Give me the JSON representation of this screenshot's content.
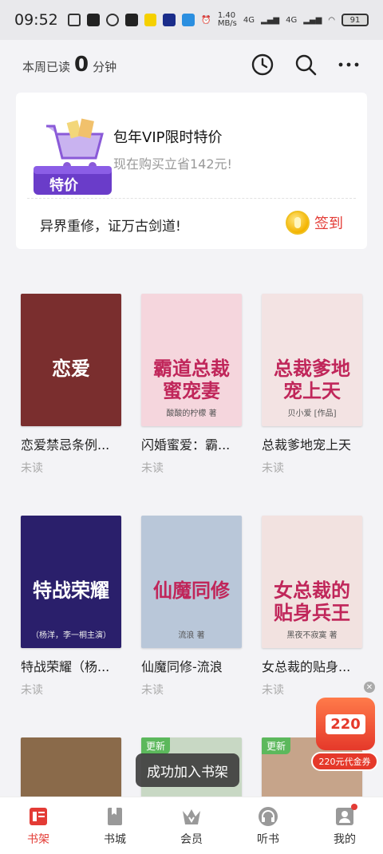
{
  "status_bar": {
    "time": "09:52",
    "net_speed": "1.40\nMB/s",
    "signal1": "4G",
    "signal2": "4G",
    "battery": "91"
  },
  "header": {
    "read_prefix": "本周已读",
    "read_minutes": "0",
    "read_suffix": "分钟"
  },
  "promo": {
    "vip_badge": "特价",
    "title": "包年VIP限时特价",
    "subtitle": "现在购买立省142元!",
    "slogan": "异界重修，证万古剑道!",
    "signin_label": "签到"
  },
  "books": [
    {
      "title": "恋爱禁忌条例...",
      "status": "未读",
      "cover_text": "恋爱",
      "cover_bg": "#7a2e2e",
      "updated": false
    },
    {
      "title": "闪婚蜜爱：霸...",
      "status": "未读",
      "cover_text": "霸道总裁\n蜜宠妻",
      "cover_sub": "酸酸的柠檬 著",
      "cover_bg": "#f5d6dd",
      "updated": false
    },
    {
      "title": "总裁爹地宠上天",
      "status": "未读",
      "cover_text": "总裁爹地\n宠上天",
      "cover_sub": "贝小爱 [作品]",
      "cover_bg": "#f3e3e3",
      "updated": false
    },
    {
      "title": "特战荣耀（杨...",
      "status": "未读",
      "cover_text": "特战荣耀",
      "cover_sub": "（杨洋，李一桐主演）",
      "cover_bg": "#2a1f6b",
      "updated": false
    },
    {
      "title": "仙魔同修-流浪",
      "status": "未读",
      "cover_text": "仙魔同修",
      "cover_sub": "流浪 著",
      "cover_bg": "#b9c7d9",
      "updated": false
    },
    {
      "title": "女总裁的贴身...",
      "status": "未读",
      "cover_text": "女总裁的\n贴身兵王",
      "cover_sub": "黑夜不寂寞 著",
      "cover_bg": "#f2e2e0",
      "updated": false
    },
    {
      "title": "",
      "status": "",
      "cover_text": "",
      "cover_bg": "#8a6a4a",
      "updated": false
    },
    {
      "title": "",
      "status": "",
      "cover_text": "",
      "cover_bg": "#c8d8c4",
      "updated": true,
      "update_label": "更新"
    },
    {
      "title": "",
      "status": "",
      "cover_text": "",
      "cover_bg": "#c6a48a",
      "updated": true,
      "update_label": "更新"
    }
  ],
  "toast": "成功加入书架",
  "coupon": {
    "value": "220",
    "label": "220元代金券"
  },
  "nav": [
    {
      "label": "书架",
      "icon": "bookshelf-icon",
      "active": true
    },
    {
      "label": "书城",
      "icon": "bookstore-icon",
      "active": false
    },
    {
      "label": "会员",
      "icon": "vip-crown-icon",
      "active": false
    },
    {
      "label": "听书",
      "icon": "headphones-icon",
      "active": false
    },
    {
      "label": "我的",
      "icon": "profile-icon",
      "active": false,
      "badge": true
    }
  ],
  "colors": {
    "accent": "#e33b35",
    "update_green": "#5cb85c",
    "vip_purple": "#6a3cc9"
  }
}
